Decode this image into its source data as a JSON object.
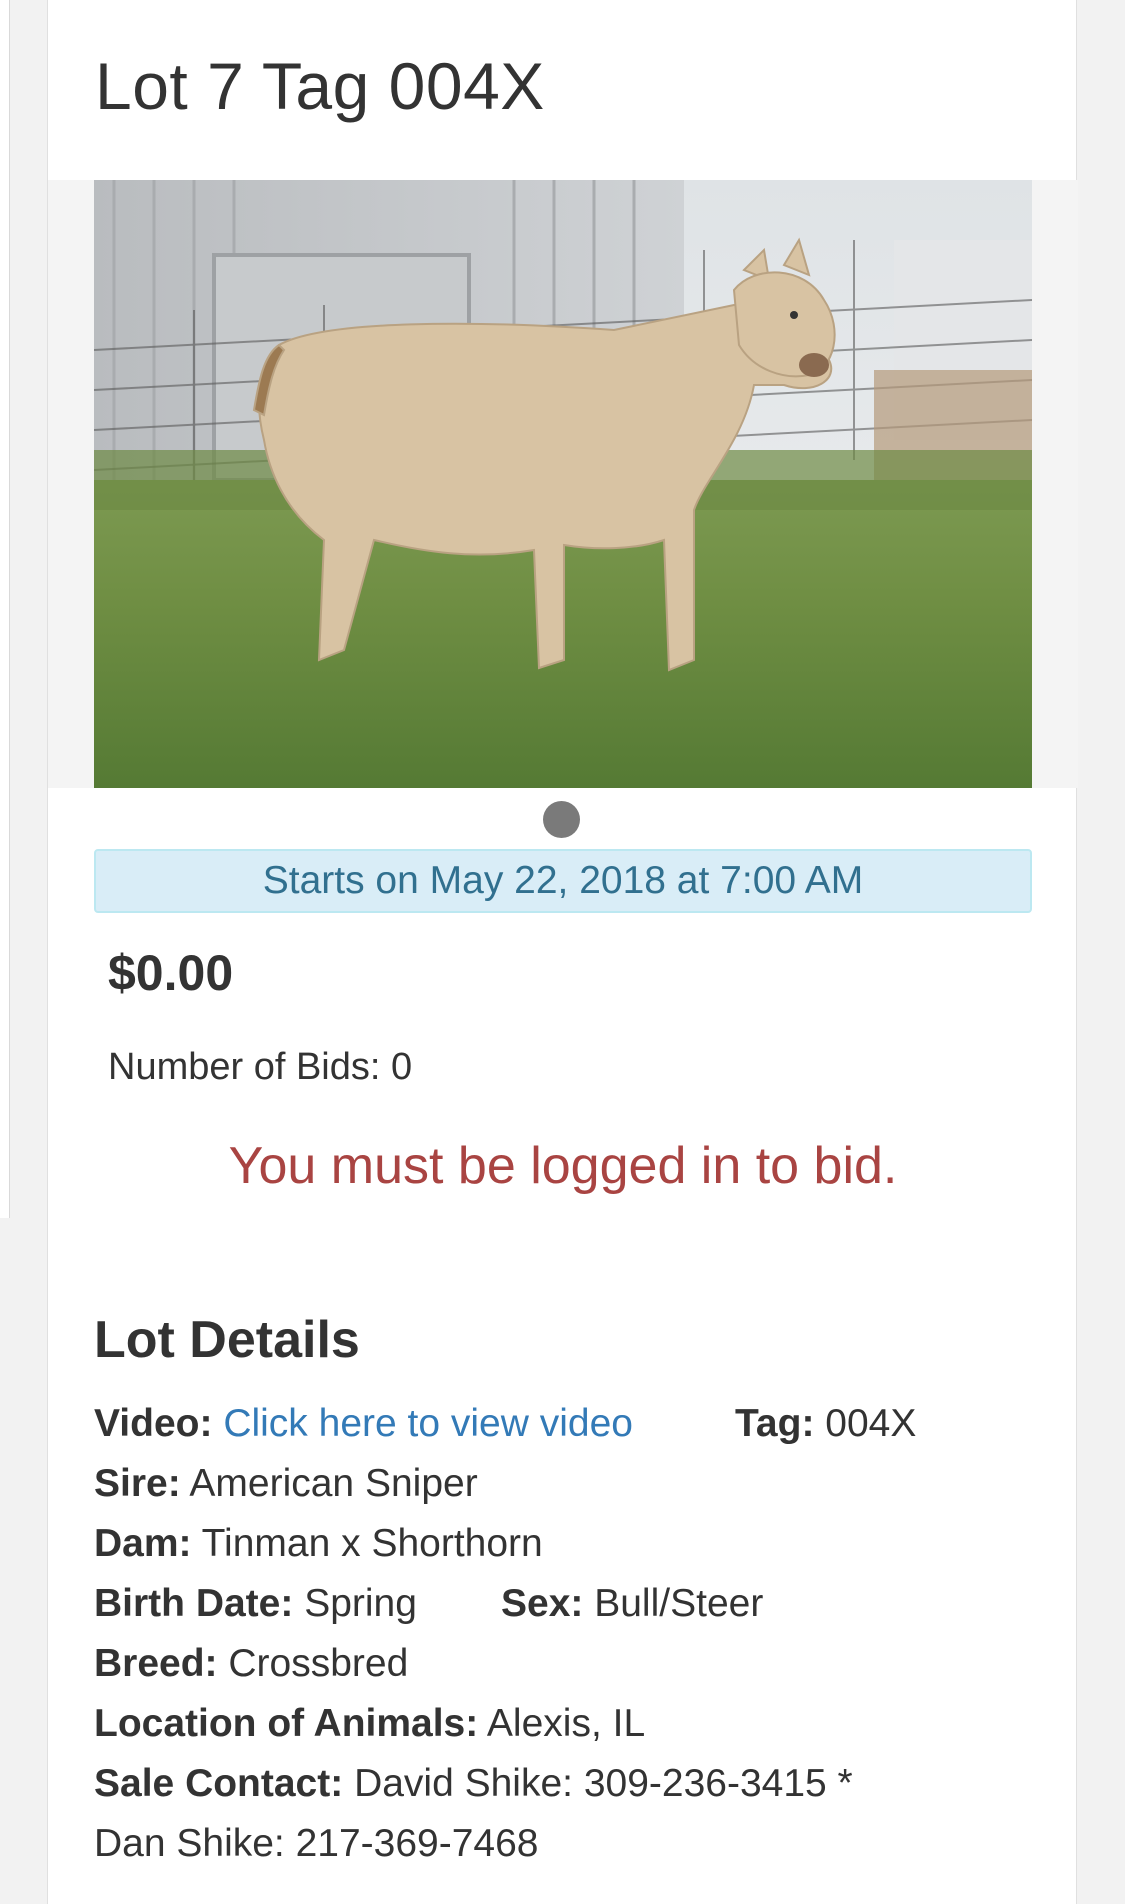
{
  "lot": {
    "title": "Lot 7 Tag 004X"
  },
  "photo": {
    "alt": "calf photo"
  },
  "auction": {
    "start_text": "Starts on May 22, 2018 at 7:00 AM",
    "price": "$0.00",
    "bids_label": "Number of Bids: ",
    "bids_count": "0",
    "login_message": "You must be logged in to bid."
  },
  "details": {
    "heading": "Lot Details",
    "video_label": "Video:",
    "video_link": "Click here to view video",
    "tag_label": "Tag:",
    "tag_value": "004X",
    "sire_label": "Sire:",
    "sire_value": "American Sniper",
    "dam_label": "Dam:",
    "dam_value": "Tinman x Shorthorn",
    "birth_label": "Birth Date:",
    "birth_value": "Spring",
    "sex_label": "Sex:",
    "sex_value": "Bull/Steer",
    "breed_label": "Breed:",
    "breed_value": "Crossbred",
    "location_label": "Location of Animals:",
    "location_value": "Alexis, IL",
    "contact_label": "Sale Contact:",
    "contact_value_line1": "David Shike: 309-236-3415 *",
    "contact_value_line2": "Dan Shike: 217-369-7468"
  },
  "colors": {
    "info_bg": "#d9edf7",
    "info_text": "#31708f",
    "danger_text": "#a94442",
    "link": "#337ab7"
  }
}
